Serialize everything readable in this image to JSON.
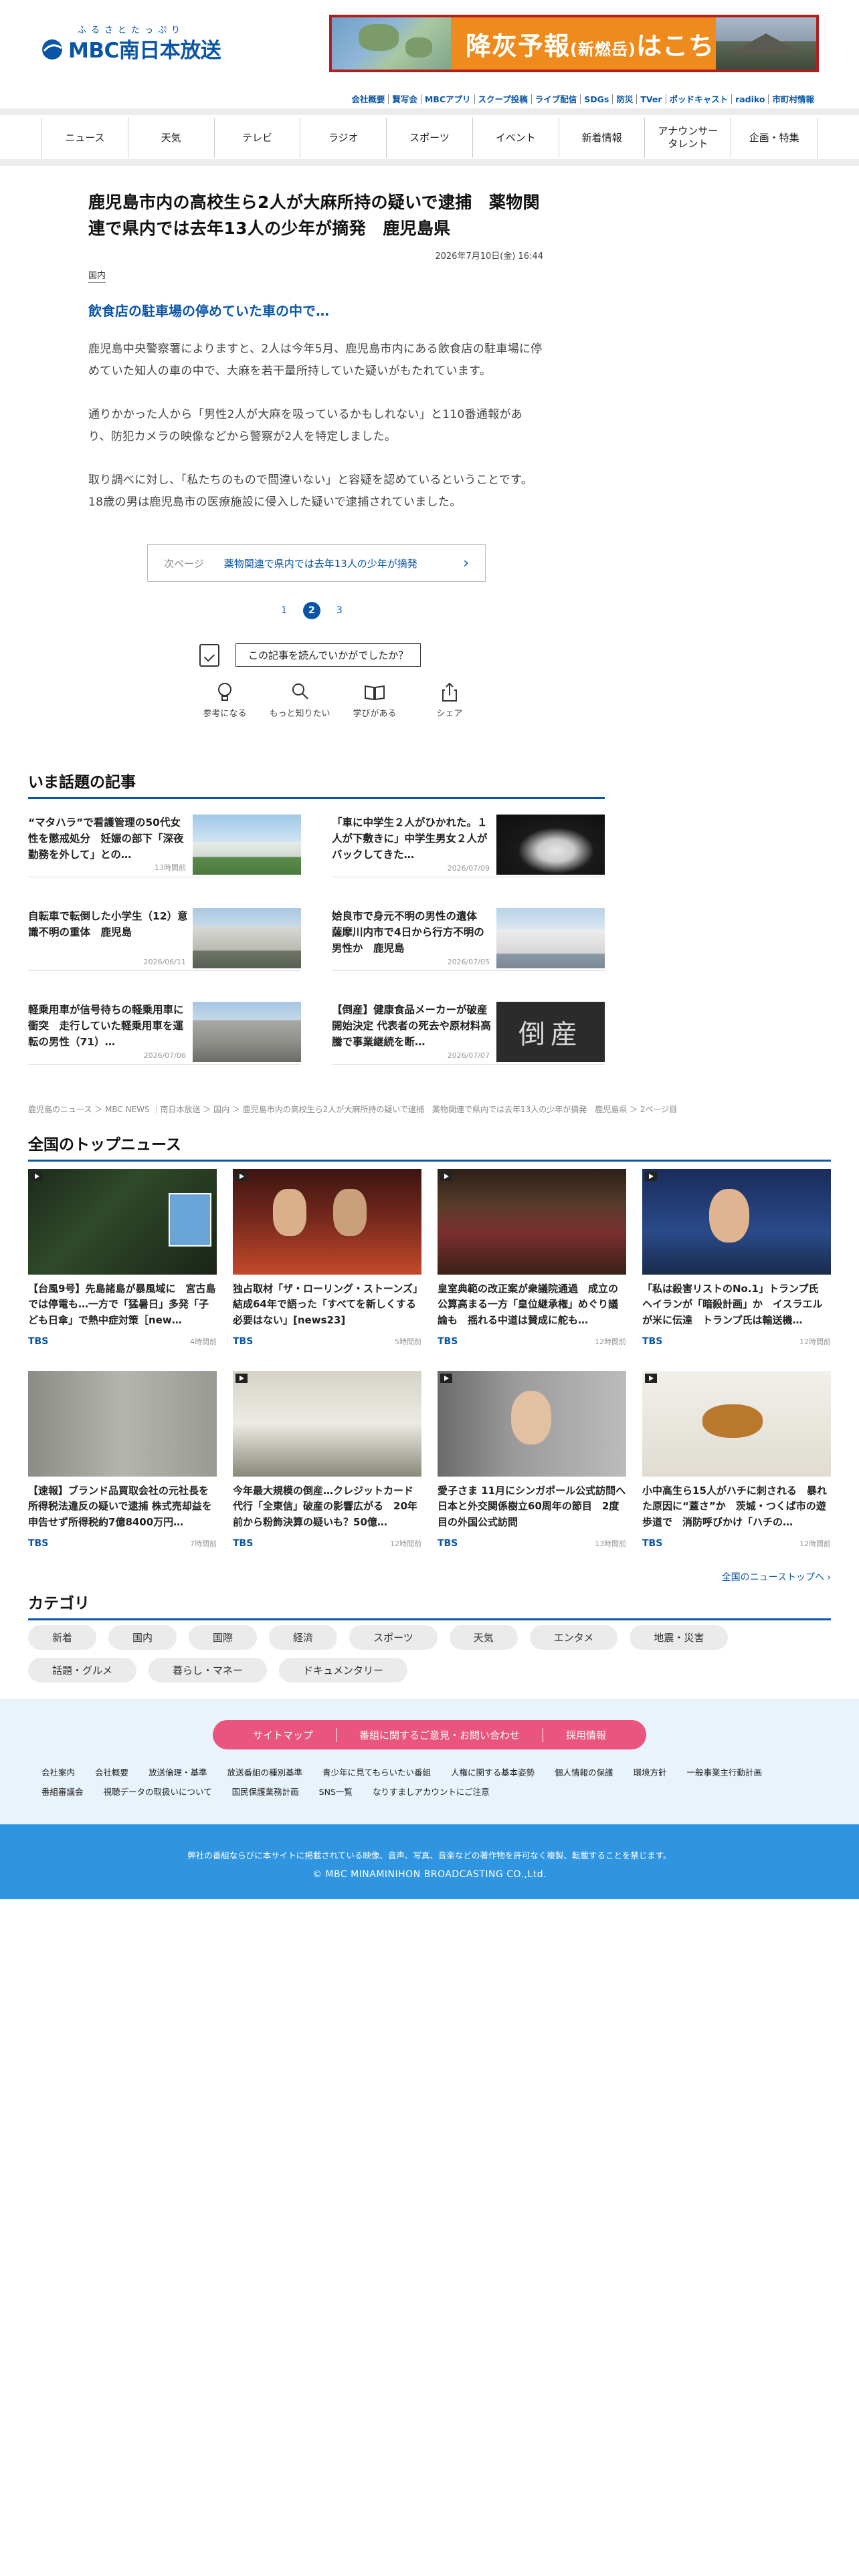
{
  "header": {
    "logo_kana": "ふるさとたっぷり",
    "logo_text": "MBC南日本放送",
    "banner_main": "降灰予報",
    "banner_paren": "(新燃岳)",
    "banner_tail": "はこちら",
    "top_links": [
      "会社概要",
      "賢写会",
      "MBCアプリ",
      "スクープ投稿",
      "ライブ配信",
      "SDGs",
      "防災",
      "TVer",
      "ポッドキャスト",
      "radiko",
      "市町村情報"
    ]
  },
  "nav": [
    "ニュース",
    "天気",
    "テレビ",
    "ラジオ",
    "スポーツ",
    "イベント",
    "新着情報",
    "アナウンサー\nタレント",
    "企画・特集"
  ],
  "article": {
    "title": "鹿児島市内の高校生ら2人が大麻所持の疑いで逮捕　薬物関連で県内では去年13人の少年が摘発　鹿児島県",
    "date": "2026年7月10日(金) 16:44",
    "category": "国内",
    "subtitle": "飲食店の駐車場の停めていた車の中で…",
    "paragraphs": [
      "鹿児島中央警察署によりますと、2人は今年5月、鹿児島市内にある飲食店の駐車場に停めていた知人の車の中で、大麻を若干量所持していた疑いがもたれています。",
      "通りかかった人から「男性2人が大麻を吸っているかもしれない」と110番通報があり、防犯カメラの映像などから警察が2人を特定しました。",
      "取り調べに対し、「私たちのもので間違いない」と容疑を認めているということです。18歳の男は鹿児島市の医療施設に侵入した疑いで逮捕されていました。"
    ],
    "next_label": "次ページ",
    "next_title": "薬物関連で県内では去年13人の少年が摘発",
    "pages": [
      "1",
      "2",
      "3"
    ],
    "current_page": "2",
    "feedback_button": "この記事を読んでいかがでしたか？",
    "reactions": [
      {
        "icon": "bulb-icon",
        "label": "参考になる"
      },
      {
        "icon": "magnifier-icon",
        "label": "もっと知りたい"
      },
      {
        "icon": "book-icon",
        "label": "学びがある"
      },
      {
        "icon": "share-icon",
        "label": "シェア"
      }
    ]
  },
  "trending": {
    "heading": "いま話題の記事",
    "items": [
      {
        "title": "“マタハラ”で看護管理の50代女性を懲戒処分　妊娠の部下「深夜勤務を外して」との…",
        "time": "13時間前"
      },
      {
        "title": "「車に中学生２人がひかれた。１人が下敷きに」中学生男女２人がバックしてきた…",
        "time": "2026/07/09"
      },
      {
        "title": "自転車で転倒した小学生（12）意識不明の重体　鹿児島",
        "time": "2026/06/11"
      },
      {
        "title": "姶良市で身元不明の男性の遺体　薩摩川内市で4日から行方不明の男性か　鹿児島",
        "time": "2026/07/05"
      },
      {
        "title": "軽乗用車が信号待ちの軽乗用車に衝突　走行していた軽乗用車を運転の男性（71）…",
        "time": "2026/07/06"
      },
      {
        "title": "【倒産】健康食品メーカーが破産開始決定 代表者の死去や原材料高騰で事業継続を断…",
        "time": "2026/07/07"
      }
    ]
  },
  "breadcrumb": "鹿児島のニュース ＞ MBC NEWS ｜南日本放送 ＞ 国内 ＞ 鹿児島市内の高校生ら2人が大麻所持の疑いで逮捕　薬物関連で県内では去年13人の少年が摘発　鹿児島県 ＞ 2ページ目",
  "national": {
    "heading": "全国のトップニュース",
    "items": [
      {
        "title": "【台風9号】先島諸島が暴風域に　宮古島では停電も…一方で「猛暑日」多発「子ども日傘」で熱中症対策［new…",
        "source": "TBS",
        "time": "4時間前"
      },
      {
        "title": "独占取材「ザ・ローリング・ストーンズ」結成64年で語った「すべてを新しくする必要はない」[news23]",
        "source": "TBS",
        "time": "5時間前"
      },
      {
        "title": "皇室典範の改正案が衆議院通過　成立の公算高まる一方「皇位継承権」めぐり議論も　揺れる中道は賛成に舵も…",
        "source": "TBS",
        "time": "12時間前"
      },
      {
        "title": "「私は殺害リストのNo.1」トランプ氏　ヘイランが「暗殺計画」か　イスラエルが米に伝達　トランプ氏は輸送機…",
        "source": "TBS",
        "time": "12時間前"
      },
      {
        "title": "【速報】ブランド品買取会社の元社長を所得税法違反の疑いで逮捕 株式売却益を申告せず所得税約7億8400万円…",
        "source": "TBS",
        "time": "7時間前"
      },
      {
        "title": "今年最大規模の倒産…クレジットカード代行「全東信」破産の影響広がる　20年前から粉飾決算の疑いも？50億…",
        "source": "TBS",
        "time": "12時間前"
      },
      {
        "title": "愛子さま 11月にシンガポール公式訪問へ　日本と外交関係樹立60周年の節目　2度目の外国公式訪問",
        "source": "TBS",
        "time": "13時間前"
      },
      {
        "title": "小中高生ら15人がハチに刺される　暴れた原因に“蓋さ”か　茨城・つくば市の遊歩道で　消防呼びかけ「ハチの…",
        "source": "TBS",
        "time": "12時間前"
      }
    ],
    "more": "全国のニューストップへ ›"
  },
  "categories": {
    "heading": "カテゴリ",
    "items": [
      "新着",
      "国内",
      "国際",
      "経済",
      "スポーツ",
      "天気",
      "エンタメ",
      "地震・災害",
      "話題・グルメ",
      "暮らし・マネー",
      "ドキュメンタリー"
    ]
  },
  "footer": {
    "pills": [
      "サイトマップ",
      "番組に関するご意見・お問い合わせ",
      "採用情報"
    ],
    "links": [
      "会社案内",
      "会社概要",
      "放送倫理・基準",
      "放送番組の種別基準",
      "青少年に見てもらいたい番組",
      "人権に関する基本姿勢",
      "個人情報の保護",
      "環境方針",
      "一般事業主行動計画",
      "番組審議会",
      "視聴データの取扱いについて",
      "国民保護業務計画",
      "SNS一覧",
      "なりすましアカウントにご注意"
    ],
    "note": "弊社の番組ならびに本サイトに掲載されている映像、音声、写真、音楽などの著作物を許可なく複製、転載することを禁じます。",
    "copyright": "© MBC MINAMINIHON BROADCASTING CO.,Ltd."
  },
  "colors": {
    "brand": "#0a56a6",
    "accent_pink": "#e9557f",
    "footer_blue": "#2f95e0"
  }
}
